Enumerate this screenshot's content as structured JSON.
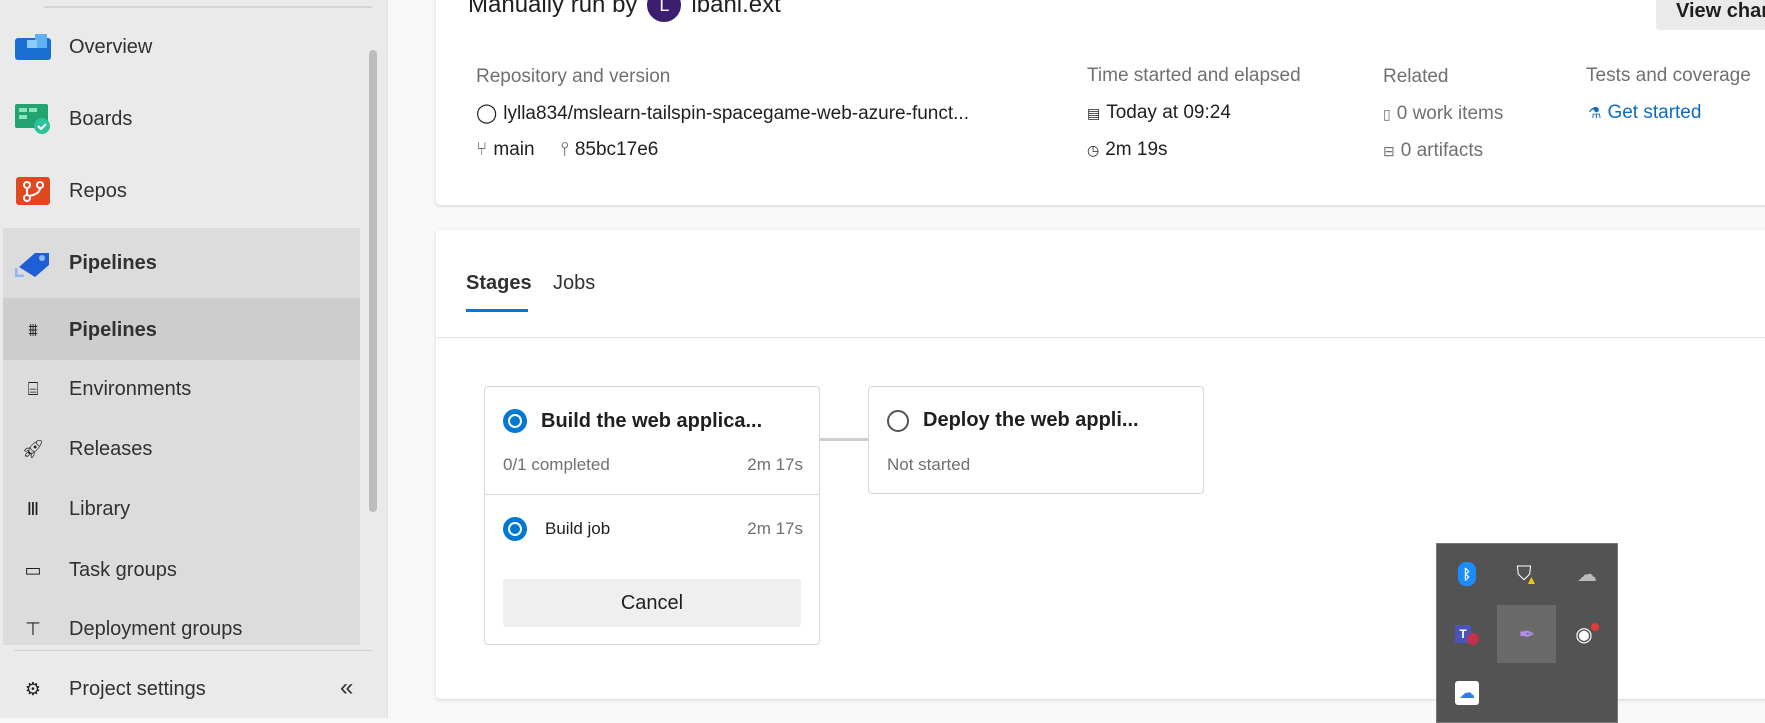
{
  "sidebar": {
    "items": [
      {
        "label": "Overview",
        "icon": "overview-icon"
      },
      {
        "label": "Boards",
        "icon": "boards-icon"
      },
      {
        "label": "Repos",
        "icon": "repos-icon"
      },
      {
        "label": "Pipelines",
        "icon": "pipelines-icon"
      }
    ],
    "subitems": [
      {
        "label": "Pipelines",
        "icon": "pipelines-list-icon"
      },
      {
        "label": "Environments",
        "icon": "environments-icon"
      },
      {
        "label": "Releases",
        "icon": "releases-icon"
      },
      {
        "label": "Library",
        "icon": "library-icon"
      },
      {
        "label": "Task groups",
        "icon": "task-groups-icon"
      },
      {
        "label": "Deployment groups",
        "icon": "deployment-groups-icon"
      }
    ],
    "settings": "Project settings",
    "collapse": "«"
  },
  "run": {
    "manual_prefix": "Manually run by",
    "avatar_letter": "L",
    "user": "lbani.ext",
    "view_changes": "View changes",
    "repo_label": "Repository and version",
    "repo": "lylla834/mslearn-tailspin-spacegame-web-azure-funct...",
    "branch": "main",
    "commit": "85bc17e6",
    "time_label": "Time started and elapsed",
    "started": "Today at 09:24",
    "elapsed": "2m 19s",
    "related_label": "Related",
    "work_items": "0 work items",
    "artifacts": "0 artifacts",
    "tests_label": "Tests and coverage",
    "get_started": "Get started"
  },
  "tabs": [
    {
      "label": "Stages",
      "active": true
    },
    {
      "label": "Jobs",
      "active": false
    }
  ],
  "stages": [
    {
      "title": "Build the web applica...",
      "status": "0/1 completed",
      "duration": "2m 17s",
      "jobs": [
        {
          "name": "Build job",
          "duration": "2m 17s"
        }
      ],
      "cancel": "Cancel"
    },
    {
      "title": "Deploy the web appli...",
      "status": "Not started"
    }
  ],
  "colors": {
    "accent": "#0078d4",
    "highlight": "#ff0000"
  }
}
